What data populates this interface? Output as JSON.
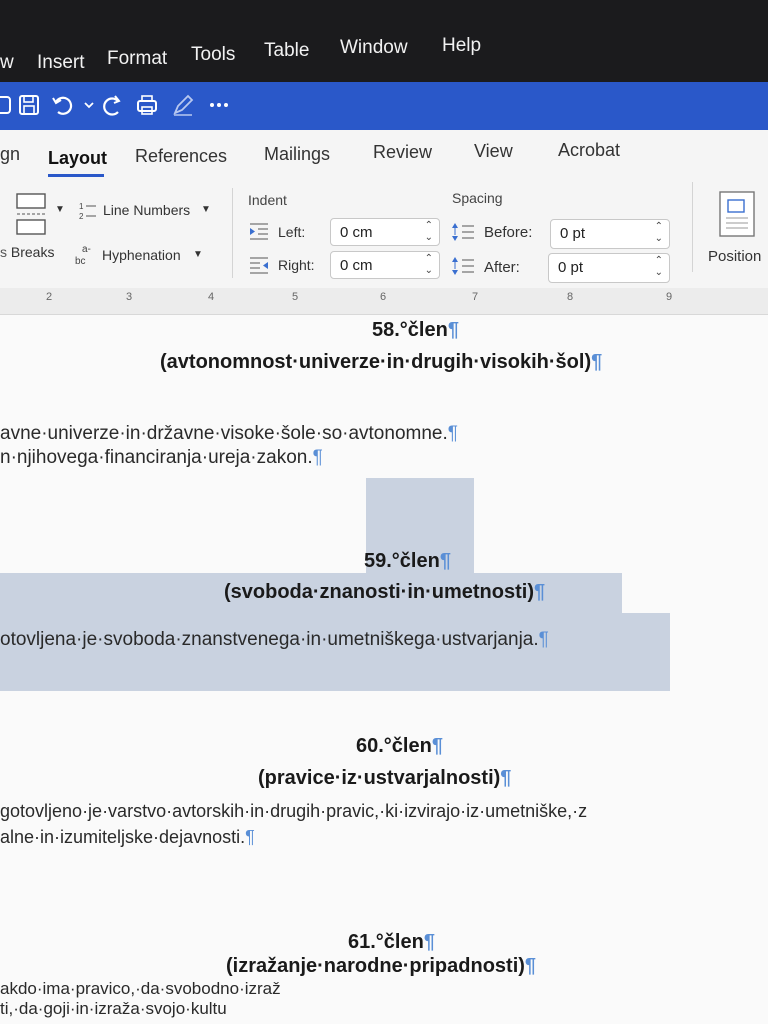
{
  "menu": [
    "w",
    "Insert",
    "Format",
    "Tools",
    "Table",
    "Window",
    "Help"
  ],
  "tabs": [
    "gn",
    "Layout",
    "References",
    "Mailings",
    "Review",
    "View",
    "Acrobat"
  ],
  "ribbon": {
    "breaks": "Breaks",
    "line_numbers": "Line Numbers",
    "hyphenation": "Hyphenation",
    "indent_title": "Indent",
    "indent_left_label": "Left:",
    "indent_left_value": "0 cm",
    "indent_right_label": "Right:",
    "indent_right_value": "0 cm",
    "spacing_title": "Spacing",
    "spacing_before_label": "Before:",
    "spacing_before_value": "0 pt",
    "spacing_after_label": "After:",
    "spacing_after_value": "0 pt",
    "position": "Position"
  },
  "ruler": [
    "2",
    "3",
    "4",
    "5",
    "6",
    "7",
    "8",
    "9"
  ],
  "document": {
    "art58_title": "58.°člen",
    "art58_sub": "(avtonomnost·univerze·in·drugih·visokih·šol)",
    "art58_p1": "avne·univerze·in·državne·visoke·šole·so·avtonomne.",
    "art58_p2": "n·njihovega·financiranja·ureja·zakon.",
    "art59_title": "59.°člen",
    "art59_sub": "(svoboda·znanosti·in·umetnosti)",
    "art59_p1": "otovljena·je·svoboda·znanstvenega·in·umetniškega·ustvarjanja.",
    "art60_title": "60.°člen",
    "art60_sub": "(pravice·iz·ustvarjalnosti)",
    "art60_p1": "gotovljeno·je·varstvo·avtorskih·in·drugih·pravic,·ki·izvirajo·iz·umetniške,·z",
    "art60_p2": "alne·in·izumiteljske·dejavnosti.",
    "art61_title": "61.°člen",
    "art61_sub": "(izražanje·narodne·pripadnosti)",
    "art61_p1": "akdo·ima·pravico,·da·svobodno·izraž",
    "art61_p2": "ti,·da·goji·in·izraža·svojo·kultu",
    "pilcrow": "¶"
  }
}
